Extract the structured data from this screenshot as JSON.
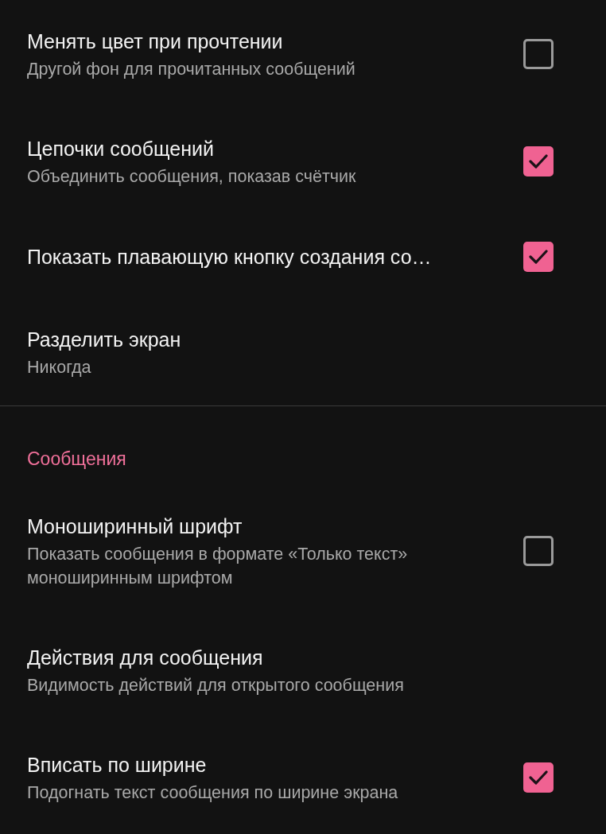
{
  "sections": [
    {
      "items": [
        {
          "kind": "checkbox",
          "title": "Менять цвет при прочтении",
          "subtitle": "Другой фон для прочитанных сообщений",
          "checked": false
        },
        {
          "kind": "checkbox",
          "title": "Цепочки сообщений",
          "subtitle": "Объединить сообщения, показав счётчик",
          "checked": true
        },
        {
          "kind": "checkbox",
          "title": "Показать плавающую кнопку создания со…",
          "checked": true
        },
        {
          "kind": "option",
          "title": "Разделить экран",
          "subtitle": "Никогда"
        }
      ]
    },
    {
      "title": "Сообщения",
      "items": [
        {
          "kind": "checkbox",
          "title": "Моноширинный шрифт",
          "subtitle": "Показать сообщения в формате «Только текст» моноширинным шрифтом",
          "checked": false
        },
        {
          "kind": "option",
          "title": "Действия для сообщения",
          "subtitle": "Видимость действий для открытого сообщения"
        },
        {
          "kind": "checkbox",
          "title": "Вписать по ширине",
          "subtitle": "Подогнать текст сообщения по ширине экрана",
          "checked": true
        }
      ]
    }
  ]
}
